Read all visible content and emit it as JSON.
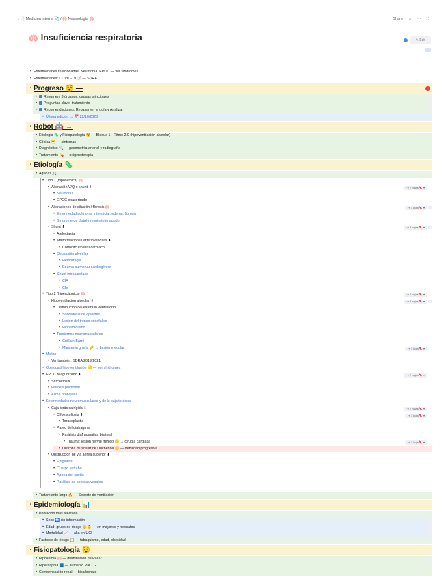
{
  "breadcrumb": {
    "back": "‹",
    "parent": "📄 Medicina interna 🩺",
    "sep": "/",
    "current": "🫁 Neumología 🫁"
  },
  "topbar_actions": {
    "share": "Share",
    "star": "☆",
    "more": "···",
    "menu": "⋮"
  },
  "page": {
    "icon": "🫁",
    "title": "Insuficiencia respiratoria",
    "edit": "✎ Edit"
  },
  "colors": {
    "yellow": "#fbf3d0",
    "green": "#e7f4e3",
    "blue": "#e5effa",
    "red": "#fde7e7",
    "link": "#3b6fd8"
  },
  "rows": [
    {
      "l": 0,
      "t": "Enfermedades relacionadas: Neumonía, EPOC — ver síndromes"
    },
    {
      "l": 0,
      "t": "Enfermedades: COVID-19 📝 — SDRA"
    },
    {
      "l": 0,
      "k": "h",
      "t": "Progreso 😵 —",
      "bg": "yellow",
      "flag": true
    },
    {
      "l": 1,
      "k": "check",
      "t": "Resumen: 3 órganos, causas principales",
      "bg": "green",
      "sq": true
    },
    {
      "l": 1,
      "k": "check",
      "t": "Preguntas clave: tratamiento",
      "bg": "green",
      "sq": true
    },
    {
      "l": 1,
      "k": "check",
      "t": "Recomendaciones: Repasar en la guía y Analizar",
      "bg": "green",
      "sq": true
    },
    {
      "l": 2,
      "t": "Última edición → 📅 22/10/2023",
      "bg": "blue",
      "c": "link"
    },
    {
      "l": 0,
      "k": "h",
      "t": "Robot 🤖 →",
      "bg": "yellow"
    },
    {
      "l": 1,
      "t": "Etiología 🦠 y Fisiopatología 😵 — Bloque 1 · Ritmo 2.0 (hipoventilación alveolar)",
      "bg": "green"
    },
    {
      "l": 1,
      "t": "Clínica 😷 — síntomas",
      "bg": "green"
    },
    {
      "l": 1,
      "t": "Diagnóstico 🔍 — gasometría arterial y radiografía",
      "bg": "green"
    },
    {
      "l": 1,
      "t": "Tratamiento 💊 — oxigenoterapia",
      "bg": "green"
    },
    {
      "l": 0,
      "k": "h",
      "t": "Etiología 🦠",
      "bg": "yellow"
    },
    {
      "l": 1,
      "t": "Agudas 🚑",
      "bg": "green"
    },
    {
      "l": 2,
      "t": "Tipo 1 (hipoxémica) 🫁"
    },
    {
      "l": 3,
      "t": "Alteración V/Q o shunt ⬇",
      "badge": "⇥ 2 hojas 🔖 ▾"
    },
    {
      "l": 4,
      "t": "Neumonía",
      "c": "link"
    },
    {
      "l": 4,
      "t": "EPOC exacerbado"
    },
    {
      "l": 3,
      "t": "Alteraciones de difusión / fibrosis 🫁",
      "badge": "⇥ 1 hoja 🔖 ▾",
      "sq": true
    },
    {
      "l": 4,
      "t": "Enfermedad pulmonar intersticial, edema, fibrosis",
      "c": "link"
    },
    {
      "l": 4,
      "t": "Síndrome de distrés respiratorio agudo",
      "c": "link"
    },
    {
      "l": 3,
      "t": "Shunt ⬇",
      "badge": "⇥ 3 hojas 🔖 ▾",
      "sq": true
    },
    {
      "l": 4,
      "t": "Atelectasia"
    },
    {
      "l": 4,
      "t": "Malformaciones arteriovenosas ⬇"
    },
    {
      "l": 5,
      "t": "Cortocircuito intracardíaco"
    },
    {
      "l": 4,
      "t": "Ocupación alveolar",
      "c": "link"
    },
    {
      "l": 5,
      "t": "Hemorragia",
      "c": "link"
    },
    {
      "l": 5,
      "t": "Edema pulmonar cardiogénico",
      "c": "link"
    },
    {
      "l": 4,
      "t": "Shunt intracardíaco",
      "c": "link"
    },
    {
      "l": 5,
      "t": "CIA",
      "c": "link"
    },
    {
      "l": 5,
      "t": "CIV",
      "c": "link"
    },
    {
      "l": 2,
      "t": "Tipo 2 (hipercápnica) 🫁",
      "badge": "⇥ 2 hojas 🔖 ▾"
    },
    {
      "l": 3,
      "t": "Hipoventilación alveolar ⬇",
      "badge": "⇥ 3 hojas 🔖 ▾",
      "sq": true
    },
    {
      "l": 4,
      "t": "Disminución del estímulo ventilatorio"
    },
    {
      "l": 5,
      "t": "Sobredosis de opioides",
      "c": "link"
    },
    {
      "l": 5,
      "t": "Lesión del tronco encefálico",
      "c": "link"
    },
    {
      "l": 5,
      "t": "Hipotiroidismo",
      "c": "link"
    },
    {
      "l": 4,
      "t": "Trastornos neuromusculares",
      "c": "link"
    },
    {
      "l": 5,
      "t": "Guillain-Barré",
      "c": "link"
    },
    {
      "l": 5,
      "t": "Miastenia gravis 🔑 → Lesión medular",
      "c": "link",
      "badge": "⇥ 1 hoja 🔖 ▾"
    },
    {
      "l": 2,
      "t": "Mixtas",
      "c": "link"
    },
    {
      "l": 3,
      "t": "Ver también: SDRA 2019/2021"
    },
    {
      "l": 2,
      "t": "Obesidad-hipoventilación 🟡 — ver síndromes",
      "c": "link"
    },
    {
      "l": 2,
      "t": "EPOC reagudizado ⬇",
      "badge": "⇥ 2 hojas 🔖 ▾"
    },
    {
      "l": 3,
      "t": "Sarcoidosis"
    },
    {
      "l": 3,
      "t": "Fibrosis pulmonar",
      "c": "link"
    },
    {
      "l": 3,
      "t": "Asma bronquial",
      "c": "link"
    },
    {
      "l": 2,
      "t": "Enfermedades neuromusculares y de la caja torácica",
      "c": "link"
    },
    {
      "l": 3,
      "t": "Caja torácica rígida ⬇",
      "badge": "⇥ 2 hojas 🔖 ▾"
    },
    {
      "l": 4,
      "t": "Cifoescoliosis ⬇",
      "badge": "⇥ 1 hoja 🔖 ▾"
    },
    {
      "l": 5,
      "t": "Toracoplastia"
    },
    {
      "l": 4,
      "t": "Pared del diafragma"
    },
    {
      "l": 5,
      "t": "Parálisis diafragmática bilateral"
    },
    {
      "l": 6,
      "t": "Trauma: lesión nervio frénico 🟡 → cirugía cardíaca",
      "badge": "⇥ 1 hoja 🔖 ▾"
    },
    {
      "l": 5,
      "t": "Distrofia muscular de Duchenne 🟡 — debilidad progresiva",
      "bg": "red"
    },
    {
      "l": 3,
      "t": "Obstrucción de vía aérea superior ⬇"
    },
    {
      "l": 4,
      "t": "Epiglotitis",
      "c": "link"
    },
    {
      "l": 4,
      "t": "Cuerpo extraño",
      "c": "link"
    },
    {
      "l": 4,
      "t": "Apnea del sueño",
      "c": "link"
    },
    {
      "l": 4,
      "t": "Parálisis de cuerdas vocales",
      "c": "link"
    },
    {
      "l": -1,
      "t": ""
    },
    {
      "l": 1,
      "t": "Tratamiento largo 🔥 — Soporte de ventilación",
      "bg": "green"
    },
    {
      "l": 0,
      "k": "h",
      "t": "Epidemiología 📊",
      "bg": "yellow"
    },
    {
      "l": 1,
      "t": "Población más afectada",
      "bg": "green"
    },
    {
      "l": 2,
      "t": "Sexo 🚻 sin información",
      "bg": "blue",
      "sq": true
    },
    {
      "l": 2,
      "t": "Edad: grupo de riesgo 👴👶 — en mayores y neonatos",
      "bg": "blue",
      "sq": true
    },
    {
      "l": 2,
      "t": "Mortalidad 📈 — alta en UCI",
      "bg": "blue",
      "sq": true
    },
    {
      "l": 1,
      "t": "Factores de riesgo 📋 — tabaquismo, edad, obesidad",
      "bg": "green"
    },
    {
      "l": 0,
      "k": "h",
      "t": "Fisiopatología 😵",
      "bg": "yellow"
    },
    {
      "l": 1,
      "t": "Hipoxemia 🫁 — disminución de PaO2",
      "bg": "green",
      "sq": true
    },
    {
      "l": 1,
      "t": "Hipercapnia 🟦 — aumento PaCO2",
      "bg": "green"
    },
    {
      "l": 1,
      "t": "Compensación renal — bicarbonato",
      "bg": "green"
    }
  ]
}
